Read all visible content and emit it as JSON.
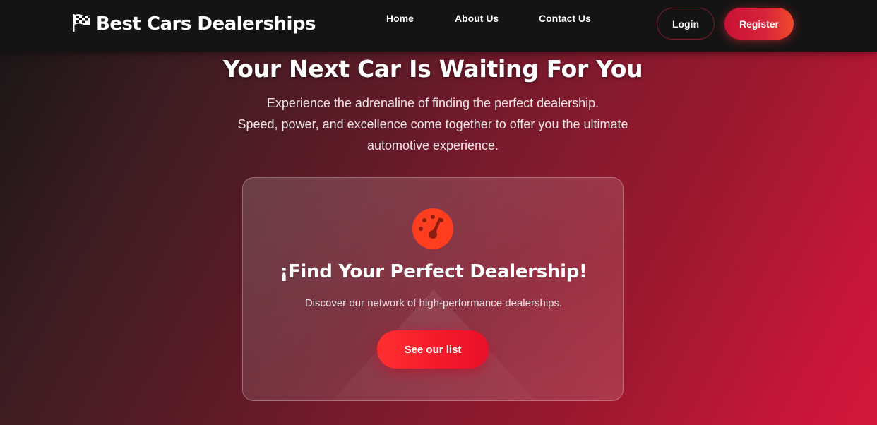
{
  "navbar": {
    "brand": {
      "title": "Best Cars Dealerships",
      "icon": "checkered-flag-icon"
    },
    "links": [
      "Home",
      "About Us",
      "Contact Us"
    ],
    "login_label": "Login",
    "register_label": "Register"
  },
  "hero": {
    "title": "Your Next Car Is Waiting For You",
    "lines": [
      "Experience the adrenaline of finding the perfect dealership.",
      "Speed, power, and excellence come together to offer you the ultimate",
      "automotive experience."
    ]
  },
  "card": {
    "icon": "speedometer-icon",
    "title": "¡Find Your Perfect Dealership!",
    "description": "Discover our network of high-performance dealerships.",
    "button_label": "See our list"
  },
  "colors": {
    "accent": "#ff3d1f",
    "register_gradient_start": "#c81236",
    "cta_red": "#f4182a",
    "navbar_bg": "#141414"
  }
}
